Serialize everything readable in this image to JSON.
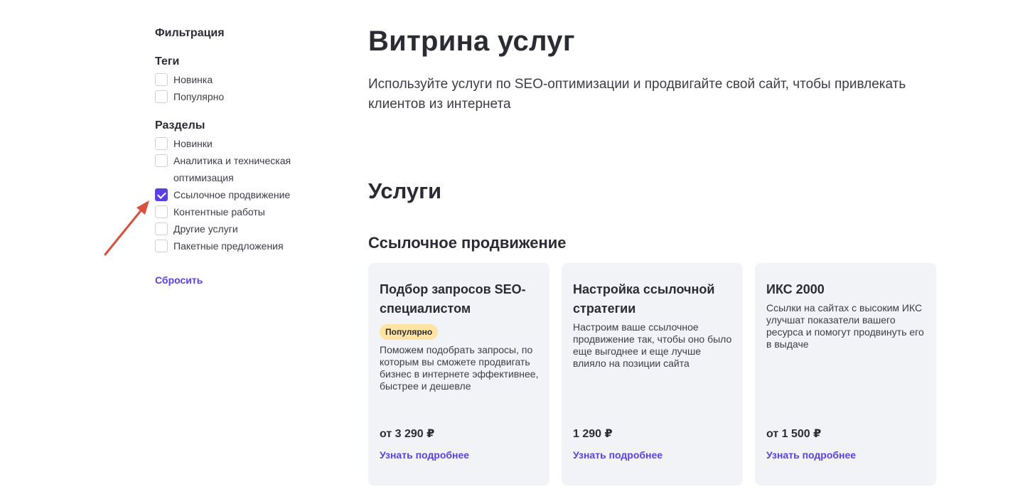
{
  "sidebar": {
    "title": "Фильтрация",
    "tags": {
      "title": "Теги",
      "items": [
        {
          "label": "Новинка",
          "checked": false
        },
        {
          "label": "Популярно",
          "checked": false
        }
      ]
    },
    "sections": {
      "title": "Разделы",
      "items": [
        {
          "label": "Новинки",
          "checked": false
        },
        {
          "label": "Аналитика и техническая оптимизация",
          "checked": false
        },
        {
          "label": "Ссылочное продвижение",
          "checked": true
        },
        {
          "label": "Контентные работы",
          "checked": false
        },
        {
          "label": "Другие услуги",
          "checked": false
        },
        {
          "label": "Пакетные предложения",
          "checked": false
        }
      ]
    },
    "reset_label": "Сбросить"
  },
  "main": {
    "title": "Витрина услуг",
    "subtitle": "Используйте услуги по SEO-оптимизации и продвигайте свой сайт, чтобы привлекать клиентов из интернета",
    "section_title": "Услуги",
    "category_title": "Ссылочное продвижение",
    "cards": [
      {
        "title": "Подбор запросов SEO-специалистом",
        "badge": "Популярно",
        "description": "Поможем подобрать запросы, по которым вы сможете продвигать бизнес в интернете эффективнее, быстрее и дешевле",
        "price": "от 3 290 ₽",
        "link": "Узнать подробнее"
      },
      {
        "title": "Настройка ссылочной стратегии",
        "badge": "",
        "description": "Настроим ваше ссылочное продвижение так, чтобы оно было еще выгоднее и еще лучше влияло на позиции сайта",
        "price": "1 290 ₽",
        "link": "Узнать подробнее"
      },
      {
        "title": "ИКС 2000",
        "badge": "",
        "description": "Ссылки на сайтах с высоким ИКС улучшат показатели вашего ресурса и помогут продвинуть его в выдаче",
        "price": "от 1 500 ₽",
        "link": "Узнать подробнее"
      }
    ]
  },
  "colors": {
    "accent": "#5b3fe0",
    "card_bg": "#f2f3f7",
    "badge_bg": "#ffe3a3",
    "annotation_arrow": "#d9503f"
  }
}
